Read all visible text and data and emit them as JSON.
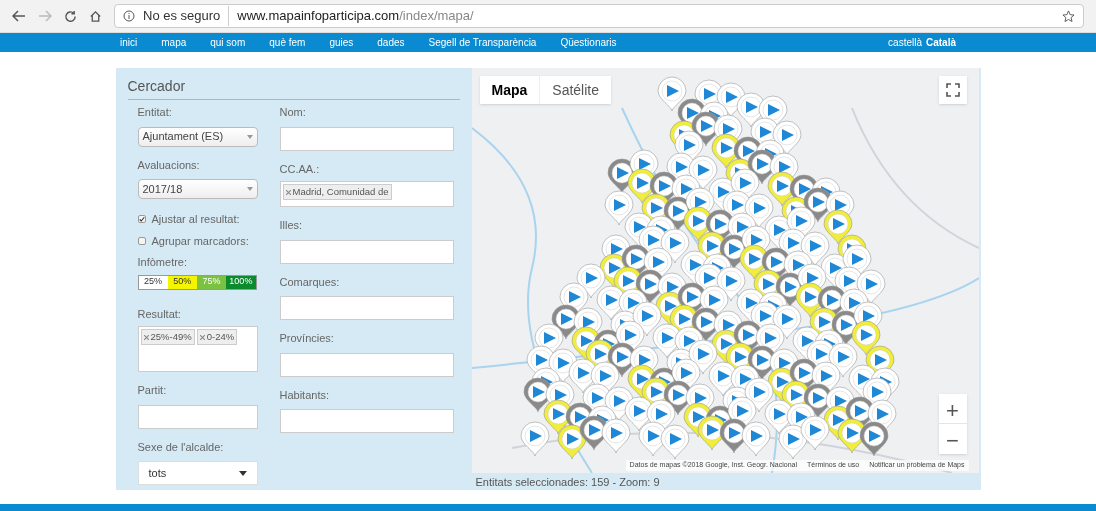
{
  "browser": {
    "security": "No es seguro",
    "url_domain": "www.mapainfoparticipa.com",
    "url_path": "/index/mapa/"
  },
  "nav": {
    "items": [
      "inici",
      "mapa",
      "qui som",
      "què fem",
      "guies",
      "dades",
      "Segell de Transparència",
      "Qüestionaris"
    ],
    "languages": [
      "castellà",
      "Català"
    ]
  },
  "search": {
    "title": "Cercador",
    "left": [
      {
        "kind": "select",
        "label": "Entitat:",
        "value": "Ajuntament (ES)"
      },
      {
        "kind": "select",
        "label": "Avaluacions:",
        "value": "2017/18"
      },
      {
        "kind": "checkbox",
        "label": "Ajustar al resultat:",
        "checked": true
      },
      {
        "kind": "checkbox",
        "label": "Agrupar marcadors:",
        "checked": false
      },
      {
        "kind": "meter",
        "label": "Infòmetre:",
        "segments": [
          {
            "text": "25%",
            "color": "#ffffff"
          },
          {
            "text": "50%",
            "color": "#f5f500"
          },
          {
            "text": "75%",
            "color": "#7cc242"
          },
          {
            "text": "100%",
            "color": "#0b8a2e"
          }
        ]
      },
      {
        "kind": "tags",
        "label": "Resultat:",
        "tags": [
          "25%-49%",
          "0-24%"
        ]
      },
      {
        "kind": "text",
        "label": "Partit:"
      },
      {
        "kind": "dropdown",
        "label": "Sexe de l'alcalde:",
        "value": "tots"
      }
    ],
    "right": [
      {
        "kind": "text",
        "label": "Nom:"
      },
      {
        "kind": "tags",
        "label": "CC.AA.:",
        "tags": [
          "Madrid, Comunidad de"
        ]
      },
      {
        "kind": "text",
        "label": "Illes:"
      },
      {
        "kind": "text",
        "label": "Comarques:"
      },
      {
        "kind": "text",
        "label": "Províncies:"
      },
      {
        "kind": "text",
        "label": "Habitants:"
      }
    ]
  },
  "map": {
    "types": [
      {
        "label": "Mapa",
        "selected": true
      },
      {
        "label": "Satélite",
        "selected": false
      }
    ],
    "attribution": [
      "Datos de mapas ©2018 Google, Inst. Geogr. Nacional",
      "Términos de uso",
      "Notificar un problema de Maps"
    ],
    "zoom_in": "+",
    "zoom_out": "−",
    "status": "Entitats seleccionades: 159 - Zoom: 9"
  }
}
